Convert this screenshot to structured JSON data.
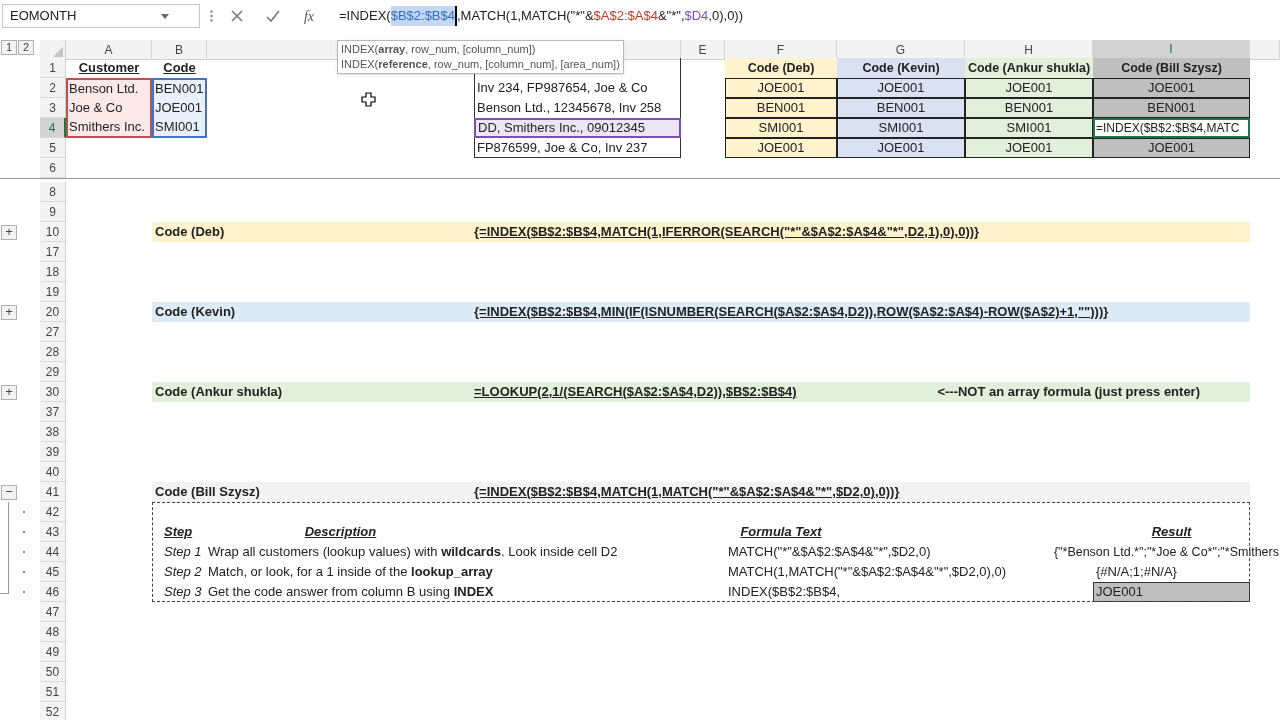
{
  "name_box": {
    "value": "EOMONTH"
  },
  "formula_bar": {
    "function_button": "fx",
    "segments": [
      {
        "text": "=INDEX(",
        "kind": "plain"
      },
      {
        "text": "$B$2:$B$4",
        "kind": "ref",
        "color": "#2f6fd0",
        "selected": true
      },
      {
        "text": ",MATCH(1,MATCH(\"*\"&",
        "kind": "plain"
      },
      {
        "text": "$A$2:$A$4",
        "kind": "ref",
        "color": "#c0392b",
        "selected": false
      },
      {
        "text": "&\"*\",",
        "kind": "plain"
      },
      {
        "text": "$D4",
        "kind": "ref",
        "color": "#7d4fb3",
        "selected": false
      },
      {
        "text": ",0),0))",
        "kind": "plain"
      }
    ]
  },
  "tooltip": {
    "lines": [
      "INDEX(**array**, row_num, [column_num])",
      "INDEX(**reference**, row_num, [column_num], [area_num])"
    ]
  },
  "outline_levels": [
    "1",
    "2"
  ],
  "columns": [
    {
      "label": "A",
      "selected": false
    },
    {
      "label": "B",
      "selected": false
    },
    {
      "selected": false
    },
    {
      "selected": false
    },
    {
      "label": "E",
      "selected": false
    },
    {
      "label": "F",
      "selected": false
    },
    {
      "label": "G",
      "selected": false
    },
    {
      "label": "H",
      "selected": false
    },
    {
      "label": "I",
      "selected": true
    },
    {
      "selected": false
    }
  ],
  "top_rows": [
    {
      "number": "1",
      "selected": false
    },
    {
      "number": "2",
      "selected": false
    },
    {
      "number": "3",
      "selected": false
    },
    {
      "number": "4",
      "selected": true
    },
    {
      "number": "5",
      "selected": false
    },
    {
      "number": "6",
      "selected": false
    }
  ],
  "customers": {
    "headers": [
      "Customer",
      "Code"
    ],
    "rows": [
      {
        "customer": "Benson Ltd.",
        "code": "BEN001"
      },
      {
        "customer": "Joe & Co",
        "code": "JOE001"
      },
      {
        "customer": "Smithers Inc.",
        "code": "SMI001"
      }
    ]
  },
  "invoices": [
    {
      "text": "Inv 234, FP987654, Joe & Co",
      "referenced": false
    },
    {
      "text": "Benson Ltd., 12345678, Inv 258",
      "referenced": false
    },
    {
      "text": "DD, Smithers Inc., 09012345",
      "referenced": true
    },
    {
      "text": "FP876599, Joe & Co, Inv 237",
      "referenced": false
    }
  ],
  "results": [
    {
      "header": "Code (Deb)",
      "color": "#fff2cc",
      "values": [
        {
          "text": "JOE001",
          "editing": false
        },
        {
          "text": "BEN001",
          "editing": false
        },
        {
          "text": "SMI001",
          "editing": false
        },
        {
          "text": "JOE001",
          "editing": false
        }
      ]
    },
    {
      "header": "Code (Kevin)",
      "color": "#d9e1f2",
      "values": [
        {
          "text": "JOE001",
          "editing": false
        },
        {
          "text": "BEN001",
          "editing": false
        },
        {
          "text": "SMI001",
          "editing": false
        },
        {
          "text": "JOE001",
          "editing": false
        }
      ]
    },
    {
      "header": "Code (Ankur shukla)",
      "color": "#e2efda",
      "values": [
        {
          "text": "JOE001",
          "editing": false
        },
        {
          "text": "BEN001",
          "editing": false
        },
        {
          "text": "SMI001",
          "editing": false
        },
        {
          "text": "JOE001",
          "editing": false
        }
      ]
    },
    {
      "header": "Code (Bill Szysz)",
      "color": "#bfbfbf",
      "values": [
        {
          "text": "JOE001",
          "editing": false
        },
        {
          "text": "BEN001",
          "editing": false
        },
        {
          "text": "=INDEX($B$2:$B$4,MATC",
          "editing": true
        },
        {
          "text": "JOE001",
          "editing": false
        }
      ]
    }
  ],
  "bottom_rows": [
    {
      "number": "8",
      "kind": "blank"
    },
    {
      "number": "9",
      "kind": "blank"
    },
    {
      "number": "10",
      "kind": "band",
      "outline_button": "+",
      "band": {
        "label": "Code (Deb)",
        "formula": "{=INDEX($B$2:$B$4,MATCH(1,IFERROR(SEARCH(\"*\"&$A$2:$A$4&\"*\",D2,1),0),0))}",
        "color": "#fff2cc"
      }
    },
    {
      "number": "17",
      "kind": "blank"
    },
    {
      "number": "18",
      "kind": "blank"
    },
    {
      "number": "19",
      "kind": "blank"
    },
    {
      "number": "20",
      "kind": "band",
      "outline_button": "+",
      "band": {
        "label": "Code (Kevin)",
        "formula": "{=INDEX($B$2:$B$4,MIN(IF(ISNUMBER(SEARCH($A$2:$A$4,D2)),ROW($A$2:$A$4)-ROW($A$2)+1,\"\")))}",
        "color": "#ddebf7"
      }
    },
    {
      "number": "27",
      "kind": "blank"
    },
    {
      "number": "28",
      "kind": "blank"
    },
    {
      "number": "29",
      "kind": "blank"
    },
    {
      "number": "30",
      "kind": "band",
      "outline_button": "+",
      "band": {
        "label": "Code (Ankur shukla)",
        "formula": "=LOOKUP(2,1/(SEARCH($A$2:$A$4,D2)),$B$2:$B$4)",
        "note": "<---NOT an array formula (just press enter)",
        "color": "#e2efda"
      }
    },
    {
      "number": "37",
      "kind": "blank"
    },
    {
      "number": "38",
      "kind": "blank"
    },
    {
      "number": "39",
      "kind": "blank"
    },
    {
      "number": "40",
      "kind": "blank"
    },
    {
      "number": "41",
      "kind": "band",
      "outline_button": "−",
      "band": {
        "label": "Code (Bill Szysz)",
        "formula": "{=INDEX($B$2:$B$4,MATCH(1,MATCH(\"*\"&$A$2:$A$4&\"*\",$D2,0),0))}",
        "color": "#f2f2f2"
      }
    },
    {
      "number": "42",
      "kind": "blank",
      "grouped": true
    },
    {
      "number": "43",
      "kind": "steps_header",
      "grouped": true,
      "cells": [
        "Step",
        "Description",
        "Formula Text",
        "Result"
      ]
    },
    {
      "number": "44",
      "kind": "step",
      "grouped": true,
      "step": "Step 1",
      "description": "Wrap all customers (lookup values) with **wildcards**. Look inside cell D2",
      "formula": "MATCH(\"*\"&$A$2:$A$4&\"*\",$D2,0)",
      "result": {
        "text": "{\"*Benson Ltd.*\";\"*Joe & Co*\";\"*Smithers",
        "kind": "overflow"
      }
    },
    {
      "number": "45",
      "kind": "step",
      "grouped": true,
      "step": "Step 2",
      "description": "Match, or look, for a 1 inside of the **lookup_array**",
      "formula": "MATCH(1,MATCH(\"*\"&$A$2:$A$4&\"*\",$D2,0),0)",
      "result": {
        "text": "{#N/A;1;#N/A}",
        "kind": "plain"
      }
    },
    {
      "number": "46",
      "kind": "step",
      "grouped": true,
      "step": "Step 3",
      "description": "Get the code answer from column B using **INDEX**",
      "formula": "INDEX($B$2:$B$4,",
      "result": {
        "text": "JOE001",
        "kind": "highlight"
      }
    },
    {
      "number": "47",
      "kind": "blank"
    },
    {
      "number": "48",
      "kind": "blank"
    },
    {
      "number": "49",
      "kind": "blank"
    },
    {
      "number": "50",
      "kind": "blank"
    },
    {
      "number": "51",
      "kind": "blank"
    },
    {
      "number": "52",
      "kind": "blank"
    }
  ]
}
